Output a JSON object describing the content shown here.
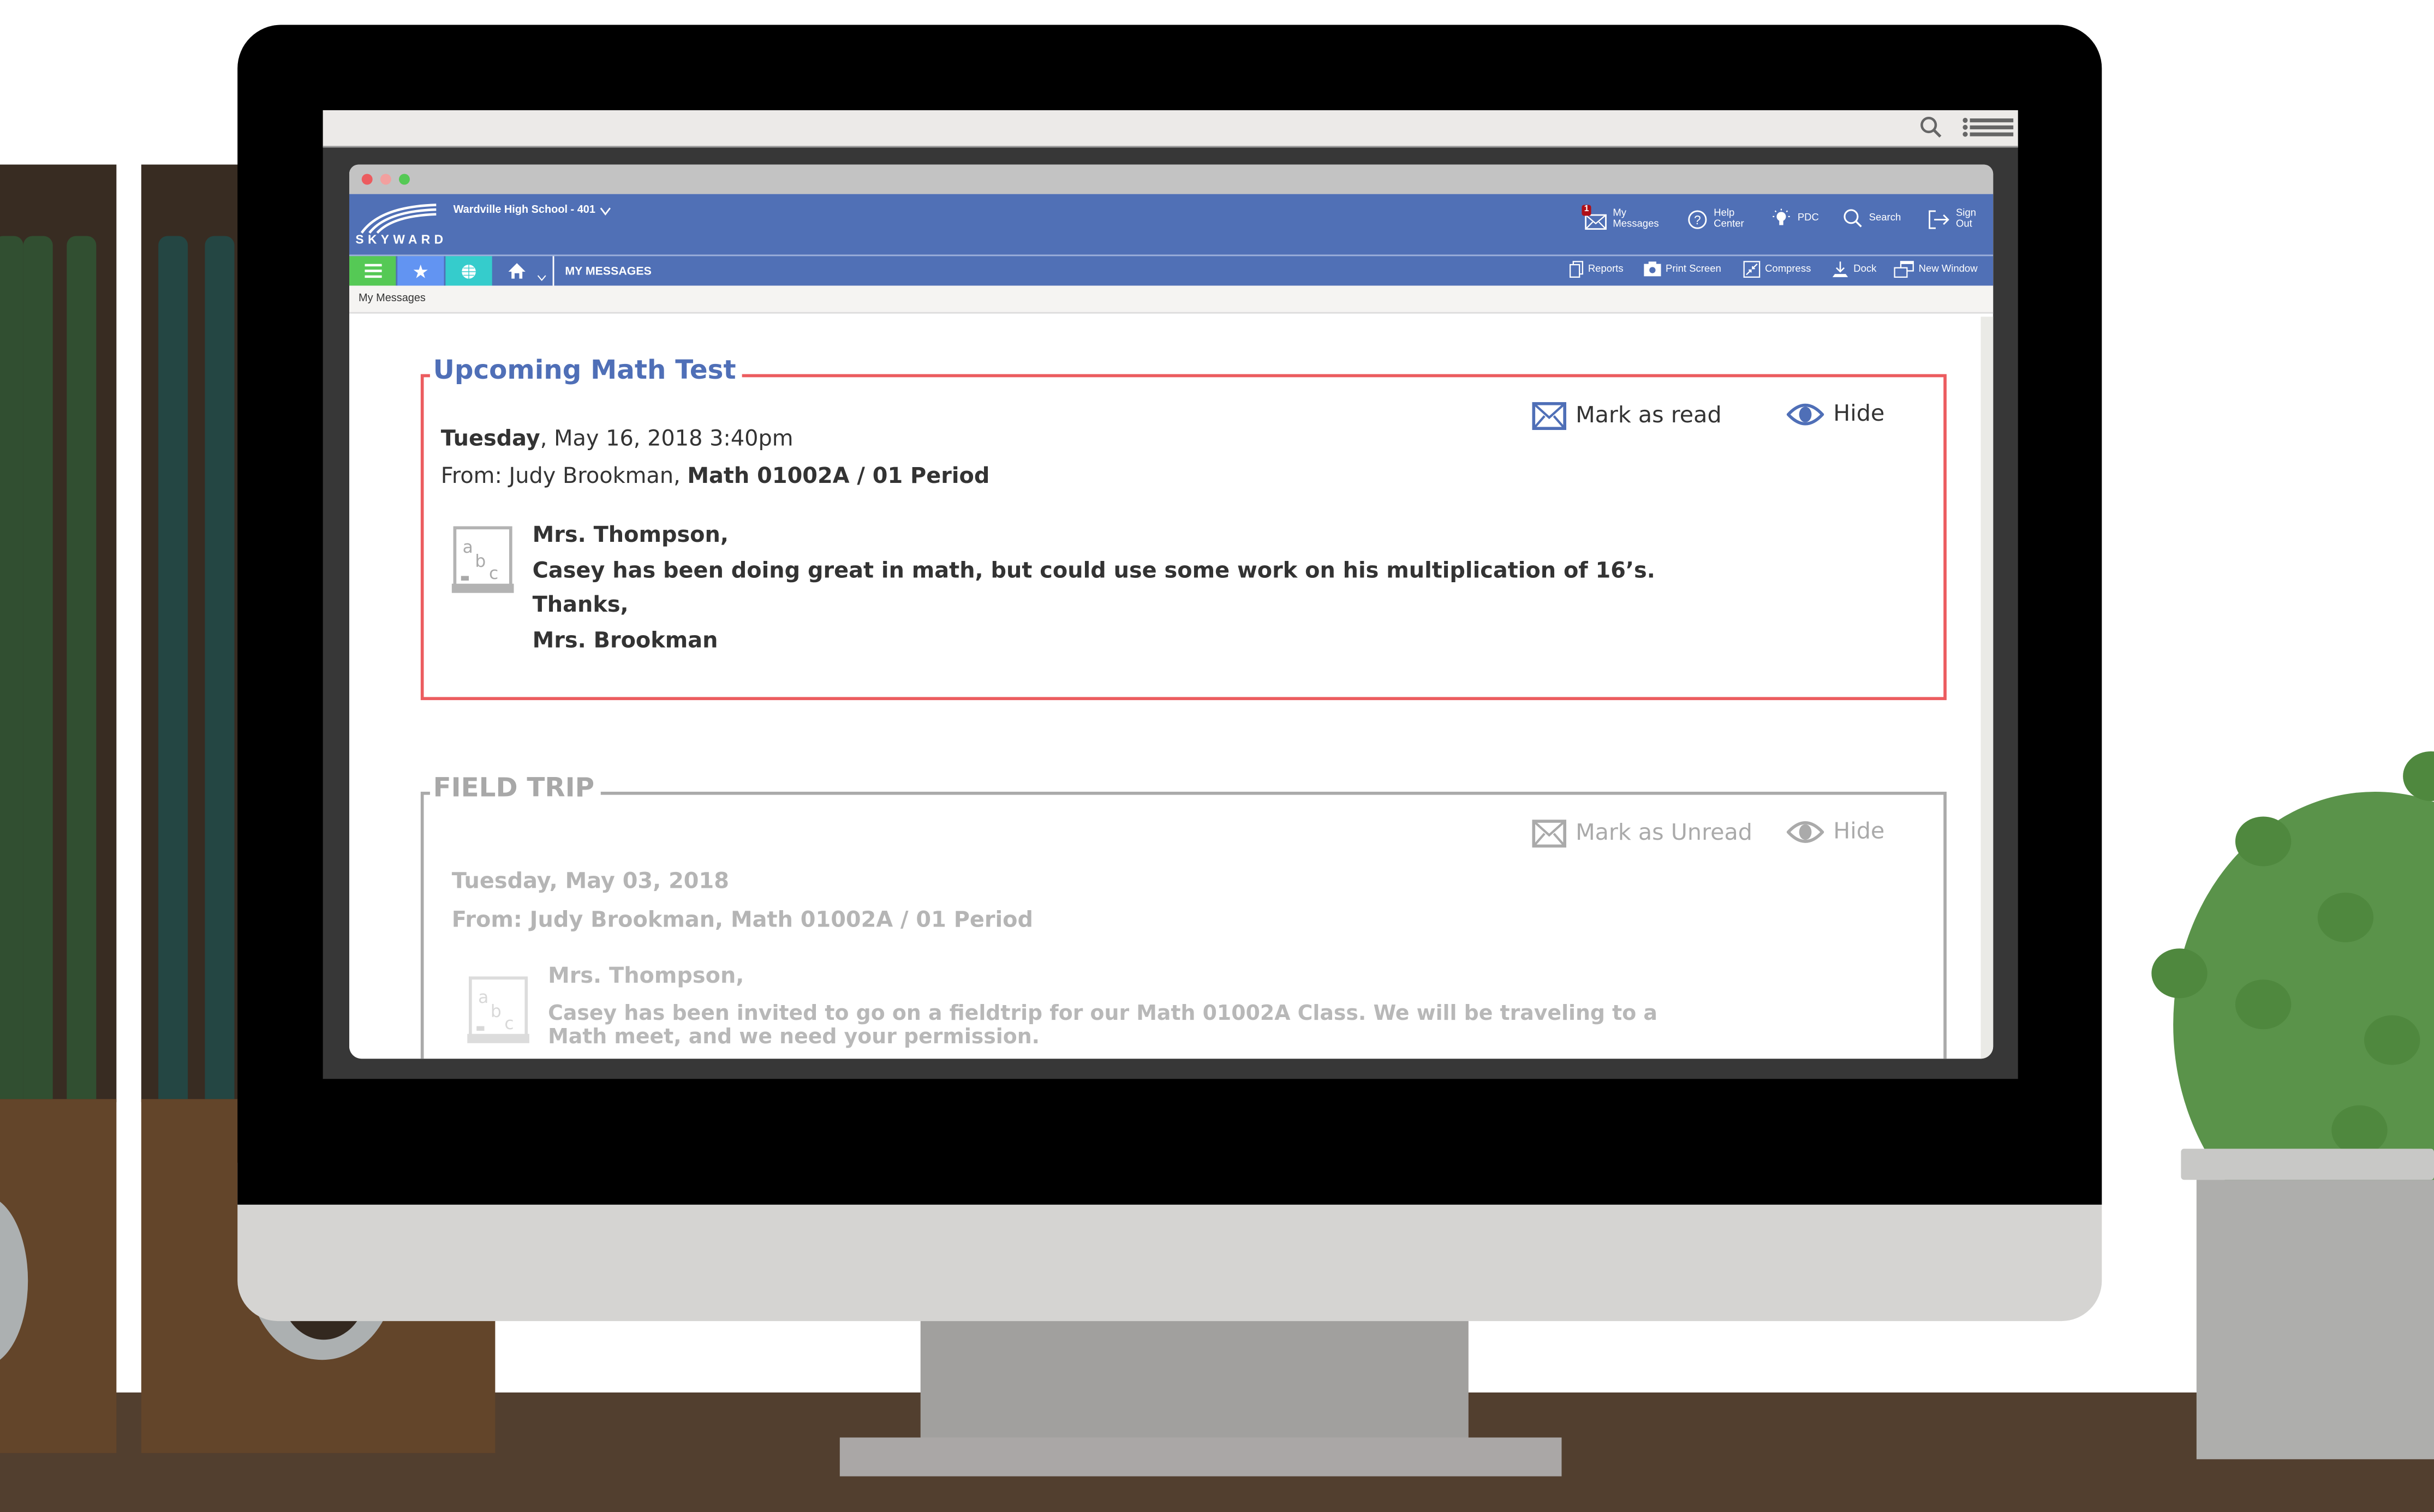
{
  "browser": {
    "search_icon": "search-icon",
    "menu_icon": "list-menu-icon"
  },
  "window": {
    "controls": [
      "close",
      "minimize",
      "maximize"
    ],
    "control_colors": [
      "#ec5c5f",
      "#f2a09f",
      "#55c955"
    ]
  },
  "header": {
    "logo_text": "SKYWARD",
    "school_selector": "Wardville High School - 401",
    "items": [
      {
        "id": "my-messages",
        "line1": "My",
        "line2": "Messages",
        "badge": "1",
        "icon": "envelope-icon"
      },
      {
        "id": "help-center",
        "line1": "Help",
        "line2": "Center",
        "icon": "help-circle-icon"
      },
      {
        "id": "pdc",
        "label": "PDC",
        "icon": "lightbulb-icon"
      },
      {
        "id": "search",
        "label": "Search",
        "icon": "search-icon"
      },
      {
        "id": "sign-out",
        "line1": "Sign",
        "line2": "Out",
        "icon": "sign-out-icon"
      }
    ]
  },
  "nav": {
    "menu_icon": "hamburger-icon",
    "favorites_icon": "star-icon",
    "globe_icon": "globe-icon",
    "home_icon": "home-icon",
    "page_title": "MY MESSAGES",
    "tools": [
      {
        "id": "reports",
        "label": "Reports",
        "icon": "reports-icon"
      },
      {
        "id": "print-screen",
        "label": "Print Screen",
        "icon": "camera-icon"
      },
      {
        "id": "compress",
        "label": "Compress",
        "icon": "compress-icon"
      },
      {
        "id": "dock",
        "label": "Dock",
        "icon": "dock-icon"
      },
      {
        "id": "new-window",
        "label": "New Window",
        "icon": "new-window-icon"
      }
    ]
  },
  "breadcrumb": "My Messages",
  "messages": [
    {
      "title": "Upcoming Math Test",
      "state": "unread",
      "date_day": "Tuesday",
      "date_rest": ", May 16, 2018 3:40pm",
      "from_prefix": "From: Judy Brookman, ",
      "from_class": "Math 01002A / 01 Period",
      "body": [
        "Mrs. Thompson,",
        "Casey has been doing great in math, but could use some work on his multiplication of 16’s.",
        "Thanks,",
        "Mrs. Brookman"
      ],
      "actions": {
        "mark": "Mark as read",
        "hide": "Hide"
      },
      "border_color": "#ec5c5f",
      "title_color": "#4f6fb7"
    },
    {
      "title": "FIELD TRIP",
      "state": "read",
      "date_day": "Tuesday",
      "date_rest": ", May 03, 2018",
      "from_prefix": "From: Judy Brookman, ",
      "from_class": "Math 01002A / 01 Period",
      "body": [
        "Mrs. Thompson,",
        "Casey has been invited to go on a fieldtrip for our Math 01002A Class. We will be traveling to a",
        "Math meet, and we need your permission."
      ],
      "actions": {
        "mark": "Mark as Unread",
        "hide": "Hide"
      },
      "border_color": "#aaaaaa",
      "title_color": "#a8a8a8"
    }
  ]
}
